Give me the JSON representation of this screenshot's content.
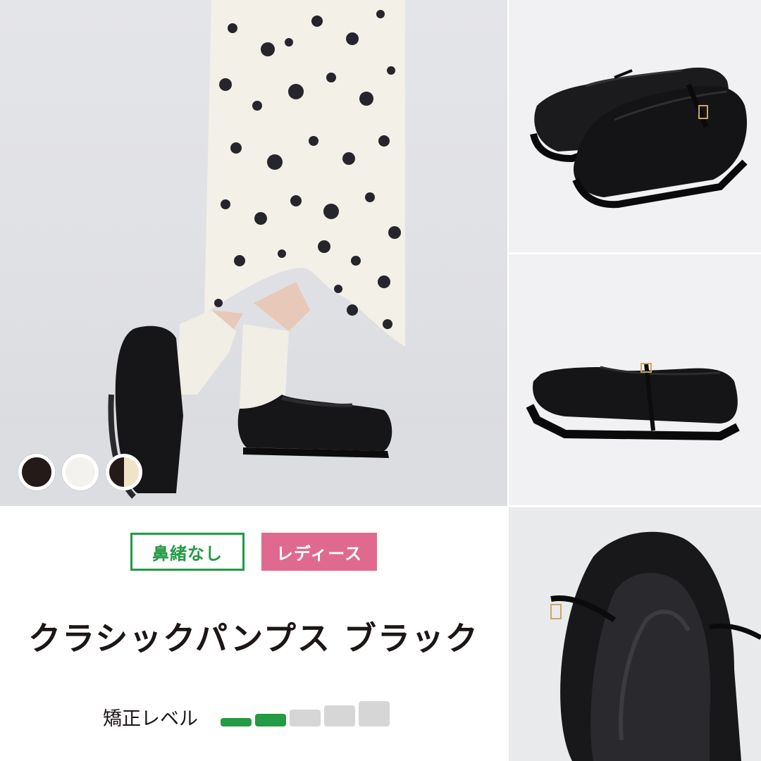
{
  "swatches": [
    {
      "label": "black",
      "color": "#241a18"
    },
    {
      "label": "white",
      "color": "#f4f2ee"
    },
    {
      "label": "black-beige",
      "color": "#efe3c8"
    }
  ],
  "tags": {
    "strapless": "鼻緒なし",
    "ladies": "レディース"
  },
  "product": {
    "title": "クラシックパンプス ブラック"
  },
  "correction_level": {
    "label": "矯正レベル",
    "value": 2,
    "max": 5,
    "active_color": "#239a44",
    "inactive_color": "#d6d6d6"
  }
}
